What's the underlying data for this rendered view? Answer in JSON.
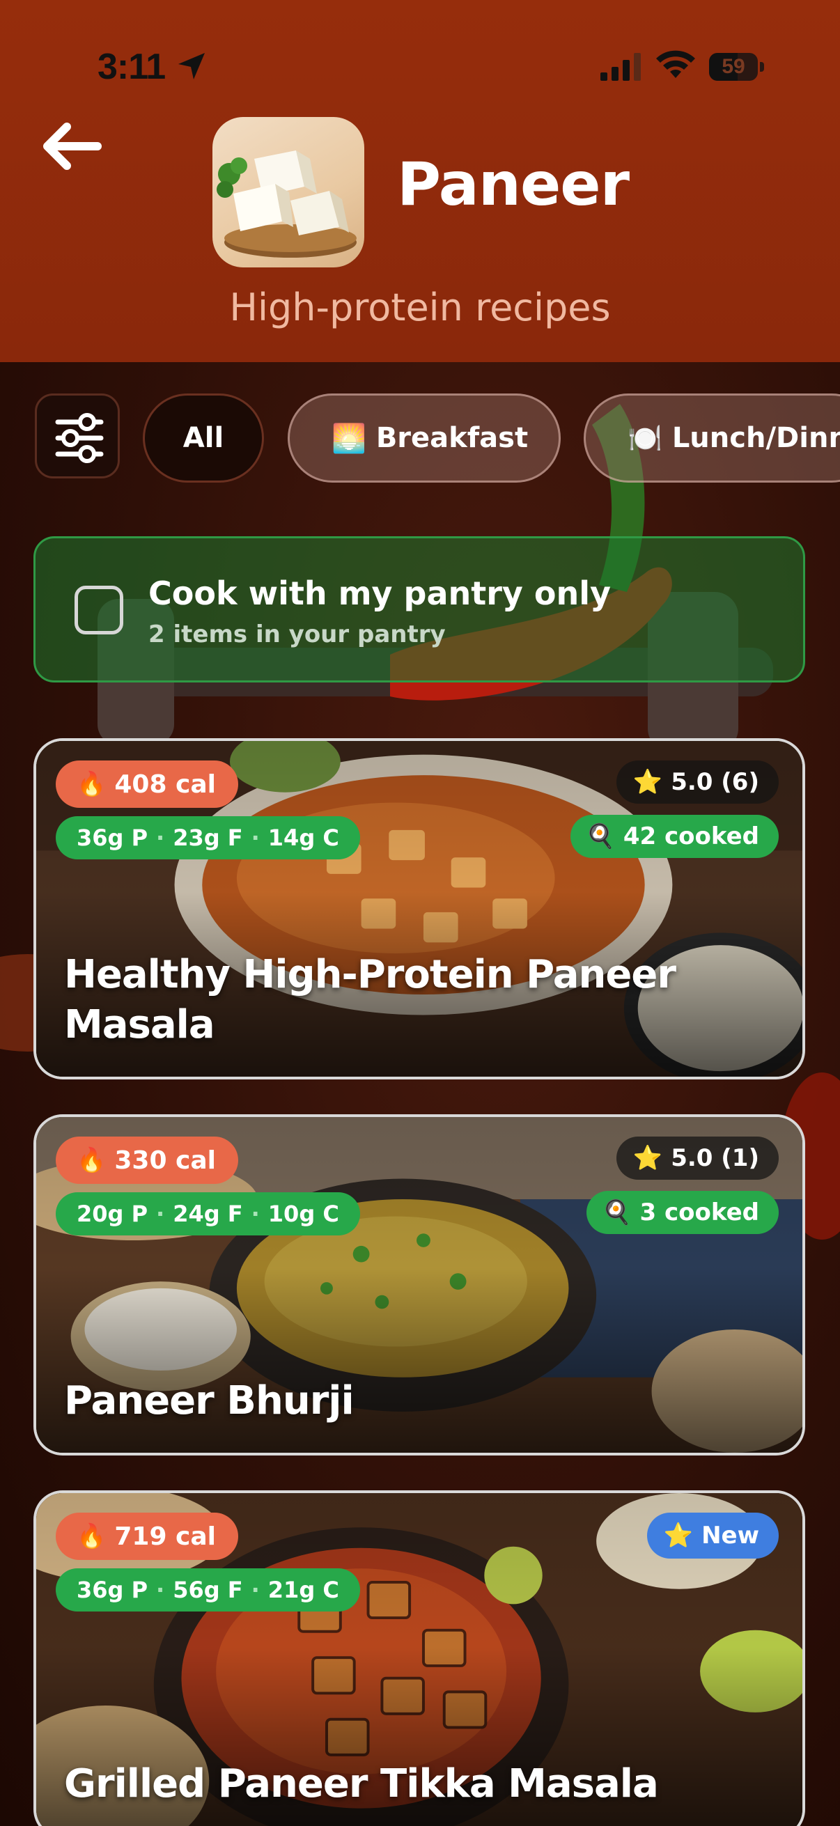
{
  "status_bar": {
    "time": "3:11",
    "battery": "59",
    "battery_level": 0.59
  },
  "header": {
    "title": "Paneer",
    "subtitle": "High-protein recipes",
    "icon": "paneer-cubes-image"
  },
  "filters": {
    "icon": "sliders-icon",
    "chips": [
      {
        "label": "All",
        "emoji": "",
        "selected": true
      },
      {
        "label": "Breakfast",
        "emoji": "🌅",
        "selected": false
      },
      {
        "label": "Lunch/Dinn",
        "emoji": "🍽️",
        "selected": false
      }
    ]
  },
  "pantry": {
    "title": "Cook with my pantry only",
    "subtitle": "2 items in your pantry",
    "checked": false
  },
  "recipes": [
    {
      "calories": "408 cal",
      "protein": "36g P",
      "fat": "23g F",
      "carbs": "14g C",
      "rating": "5.0 (6)",
      "cooked": "42 cooked",
      "title": "Healthy High-Protein Paneer Masala"
    },
    {
      "calories": "330 cal",
      "protein": "20g P",
      "fat": "24g F",
      "carbs": "10g C",
      "rating": "5.0 (1)",
      "cooked": "3 cooked",
      "title": "Paneer Bhurji"
    },
    {
      "calories": "719 cal",
      "protein": "36g P",
      "fat": "56g F",
      "carbs": "21g C",
      "badge": "New",
      "title": "Grilled Paneer Tikka Masala"
    }
  ],
  "colors": {
    "header": "#8f2a0c",
    "calorie_badge": "#e86848",
    "macro_badge": "#27a84a",
    "new_badge": "#3f7ee0"
  }
}
